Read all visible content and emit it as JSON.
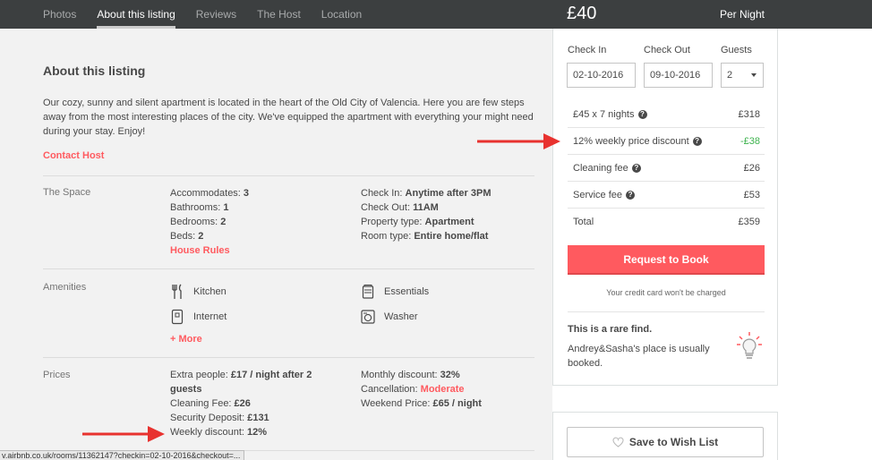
{
  "nav": {
    "tabs": [
      "Photos",
      "About this listing",
      "Reviews",
      "The Host",
      "Location"
    ],
    "active": "About this listing"
  },
  "price_header": {
    "amount": "£40",
    "per": "Per Night"
  },
  "about": {
    "title": "About this listing",
    "description": "Our cozy, sunny and silent apartment is located in the heart of the Old City of Valencia. Here you are few steps away from the most interesting places of the city. We've equipped the apartment with everything your might need during your stay. Enjoy!",
    "contact": "Contact Host"
  },
  "space": {
    "label": "The Space",
    "accommodates_label": "Accommodates: ",
    "accommodates": "3",
    "bathrooms_label": "Bathrooms: ",
    "bathrooms": "1",
    "bedrooms_label": "Bedrooms: ",
    "bedrooms": "2",
    "beds_label": "Beds: ",
    "beds": "2",
    "house_rules": "House Rules",
    "checkin_label": "Check In: ",
    "checkin": "Anytime after 3PM",
    "checkout_label": "Check Out: ",
    "checkout": "11AM",
    "property_label": "Property type: ",
    "property": "Apartment",
    "room_label": "Room type: ",
    "room": "Entire home/flat"
  },
  "amenities": {
    "label": "Amenities",
    "items": [
      {
        "name": "Kitchen",
        "icon": "kitchen-icon"
      },
      {
        "name": "Internet",
        "icon": "internet-icon"
      },
      {
        "name": "Essentials",
        "icon": "essentials-icon"
      },
      {
        "name": "Washer",
        "icon": "washer-icon"
      }
    ],
    "more": "+ More"
  },
  "prices": {
    "label": "Prices",
    "extra_label": "Extra people: ",
    "extra": "£17 / night after 2 guests",
    "cleaning_label": "Cleaning Fee: ",
    "cleaning": "£26",
    "deposit_label": "Security Deposit: ",
    "deposit": "£131",
    "weekly_label": "Weekly discount: ",
    "weekly": "12%",
    "monthly_label": "Monthly discount: ",
    "monthly": "32%",
    "cancel_label": "Cancellation: ",
    "cancel": "Moderate",
    "weekend_label": "Weekend Price: ",
    "weekend": "£65 / night"
  },
  "booking": {
    "checkin_label": "Check In",
    "checkin_value": "02-10-2016",
    "checkout_label": "Check Out",
    "checkout_value": "09-10-2016",
    "guests_label": "Guests",
    "guests_value": "2",
    "rows": [
      {
        "label": "£45 x 7 nights",
        "value": "£318",
        "help": true
      },
      {
        "label": "12% weekly price discount",
        "value": "-£38",
        "help": true,
        "highlight": true
      },
      {
        "label": "Cleaning fee",
        "value": "£26",
        "help": true
      },
      {
        "label": "Service fee",
        "value": "£53",
        "help": true
      },
      {
        "label": "Total",
        "value": "£359",
        "help": false
      }
    ],
    "book_button": "Request to Book",
    "no_charge": "Your credit card won't be charged",
    "rare_title": "This is a rare find.",
    "rare_text": "Andrey&Sasha's place is usually booked."
  },
  "wishlist": {
    "label": "Save to Wish List"
  },
  "status_url": "v.airbnb.co.uk/rooms/11362147?checkin=02-10-2016&checkout=...",
  "colors": {
    "brand": "#ff5a5f",
    "discount": "#3fb34f",
    "nav_bg": "#3c3f40",
    "arrow": "#e8322f"
  }
}
